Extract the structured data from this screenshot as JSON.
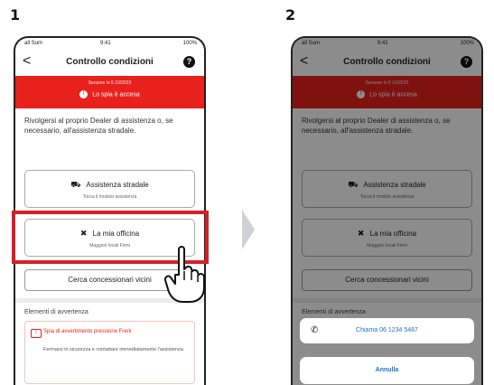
{
  "steps": {
    "first": "1",
    "second": "2"
  },
  "statusbar": {
    "signal": "all Sum",
    "time": "9:41",
    "battery": "100%"
  },
  "nav": {
    "back": "<",
    "title": "Controllo condizioni",
    "help": "?"
  },
  "banner": {
    "line1": "Sensore lo 5 10/2023",
    "alert": "Lo spia è accesa"
  },
  "intro": "Rivolgersi al proprio Dealer di assistenza o, se necessario, all'assistenza stradale.",
  "options": {
    "road": {
      "label": "Assistenza stradale",
      "sub": "Tocca il modulo assistenza",
      "icon": "tow-truck-icon"
    },
    "workshop": {
      "label": "La mia officina",
      "sub": "Maggiori locali Firmi",
      "icon": "wrench-icon"
    }
  },
  "cerca": "Cerca concessionari vicini",
  "warnings": {
    "title": "Elementi di avvertenza",
    "item_title": "Spia di avvertimento pressione Freni",
    "item_body": "Fermarsi in sicurezza e contattare immediatamente l'assistenza"
  },
  "sheet": {
    "call": "Chiama 06 1234 5487",
    "cancel": "Annulla"
  },
  "colors": {
    "brand_red": "#e8211d",
    "highlight": "#d5202a",
    "link_blue": "#1f6fd1"
  }
}
